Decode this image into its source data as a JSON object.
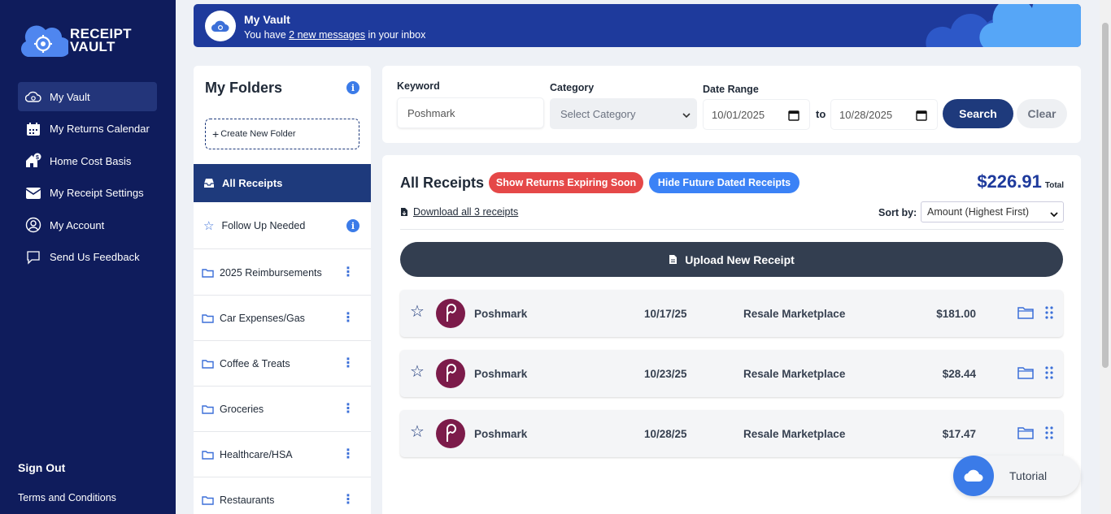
{
  "brand": {
    "line1": "RECEIPT",
    "line2": "VAULT"
  },
  "nav": [
    {
      "label": "My Vault",
      "icon": "vault-icon",
      "active": true
    },
    {
      "label": "My Returns Calendar",
      "icon": "calendar-icon"
    },
    {
      "label": "Home Cost Basis",
      "icon": "home-dollar-icon"
    },
    {
      "label": "My Receipt Settings",
      "icon": "envelope-icon"
    },
    {
      "label": "My Account",
      "icon": "user-circle-icon"
    },
    {
      "label": "Send Us Feedback",
      "icon": "chat-icon"
    }
  ],
  "sidebar_footer": {
    "signout": "Sign Out",
    "terms": "Terms and Conditions"
  },
  "banner": {
    "title": "My Vault",
    "prefix": "You have ",
    "link": "2 new messages",
    "suffix": " in your inbox"
  },
  "folders": {
    "title": "My Folders",
    "create": "Create New Folder",
    "all": "All Receipts",
    "follow_up": "Follow Up Needed",
    "items": [
      "2025 Reimbursements",
      "Car Expenses/Gas",
      "Coffee & Treats",
      "Groceries",
      "Healthcare/HSA",
      "Restaurants"
    ]
  },
  "search": {
    "keyword_label": "Keyword",
    "keyword_placeholder": "Poshmark",
    "category_label": "Category",
    "category_value": "Select Category",
    "date_label": "Date Range",
    "date_from": "10/01/2025",
    "to": "to",
    "date_to": "10/28/2025",
    "search_btn": "Search",
    "clear_btn": "Clear"
  },
  "receipts": {
    "title": "All Receipts",
    "expiring_btn": "Show Returns Expiring Soon",
    "future_btn": "Hide Future Dated Receipts",
    "total": "$226.91",
    "total_label": "Total",
    "download": "Download all 3 receipts",
    "sort_label": "Sort by:",
    "sort_value": "Amount (Highest First)",
    "upload": "Upload New Receipt",
    "rows": [
      {
        "merchant": "Poshmark",
        "date": "10/17/25",
        "category": "Resale Marketplace",
        "amount": "$181.00"
      },
      {
        "merchant": "Poshmark",
        "date": "10/23/25",
        "category": "Resale Marketplace",
        "amount": "$28.44"
      },
      {
        "merchant": "Poshmark",
        "date": "10/28/25",
        "category": "Resale Marketplace",
        "amount": "$17.47"
      }
    ]
  },
  "tutorial": {
    "label": "Tutorial"
  },
  "colors": {
    "sidebar": "#0f1c5c",
    "accent": "#1e3a7c",
    "danger": "#e54848",
    "info": "#3b82f6",
    "banner": "#1e3a9c"
  }
}
